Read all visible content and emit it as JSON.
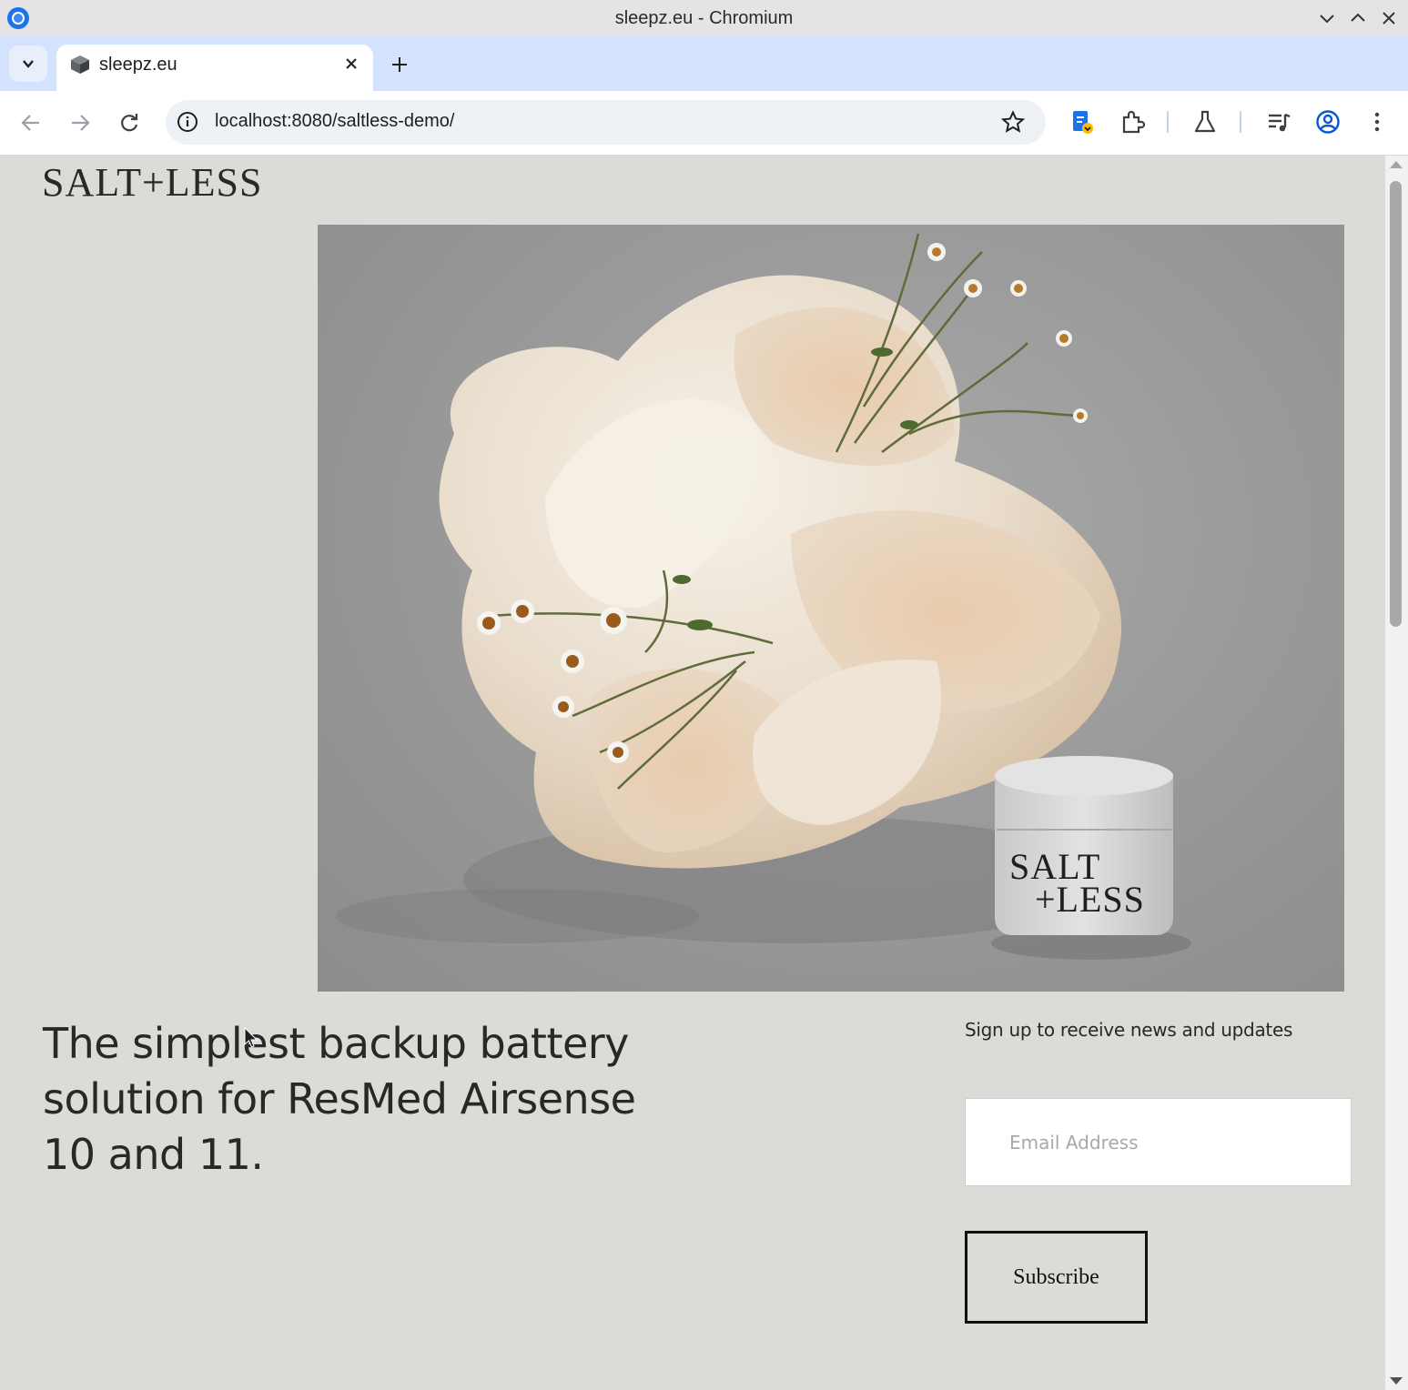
{
  "window": {
    "title": "sleepz.eu - Chromium"
  },
  "tabs": [
    {
      "title": "sleepz.eu",
      "active": true
    }
  ],
  "toolbar": {
    "url_host": "localhost",
    "url_rest": ":8080/saltless-demo/"
  },
  "icons": {
    "chromium": "chromium-logo",
    "back": "arrow-left",
    "forward": "arrow-right",
    "reload": "reload",
    "site_info": "info",
    "bookmark": "star",
    "extensions": "puzzle",
    "labs": "flask",
    "media": "media-queue",
    "profile": "person-circle",
    "menu": "three-dots-vertical"
  },
  "page": {
    "brand": "SALT+LESS",
    "hero_jar_label_line1": "SALT",
    "hero_jar_label_line2": "+LESS",
    "headline": "The simplest backup battery solution for ResMed Airsense 10 and 11.",
    "signup": {
      "label": "Sign up to receive news and updates",
      "email_placeholder": "Email Address",
      "email_value": "",
      "button_label": "Subscribe"
    }
  },
  "colors": {
    "page_background": "#dcdbd7",
    "tabstrip": "#d3e3fd",
    "accent": "#0b57d0"
  }
}
